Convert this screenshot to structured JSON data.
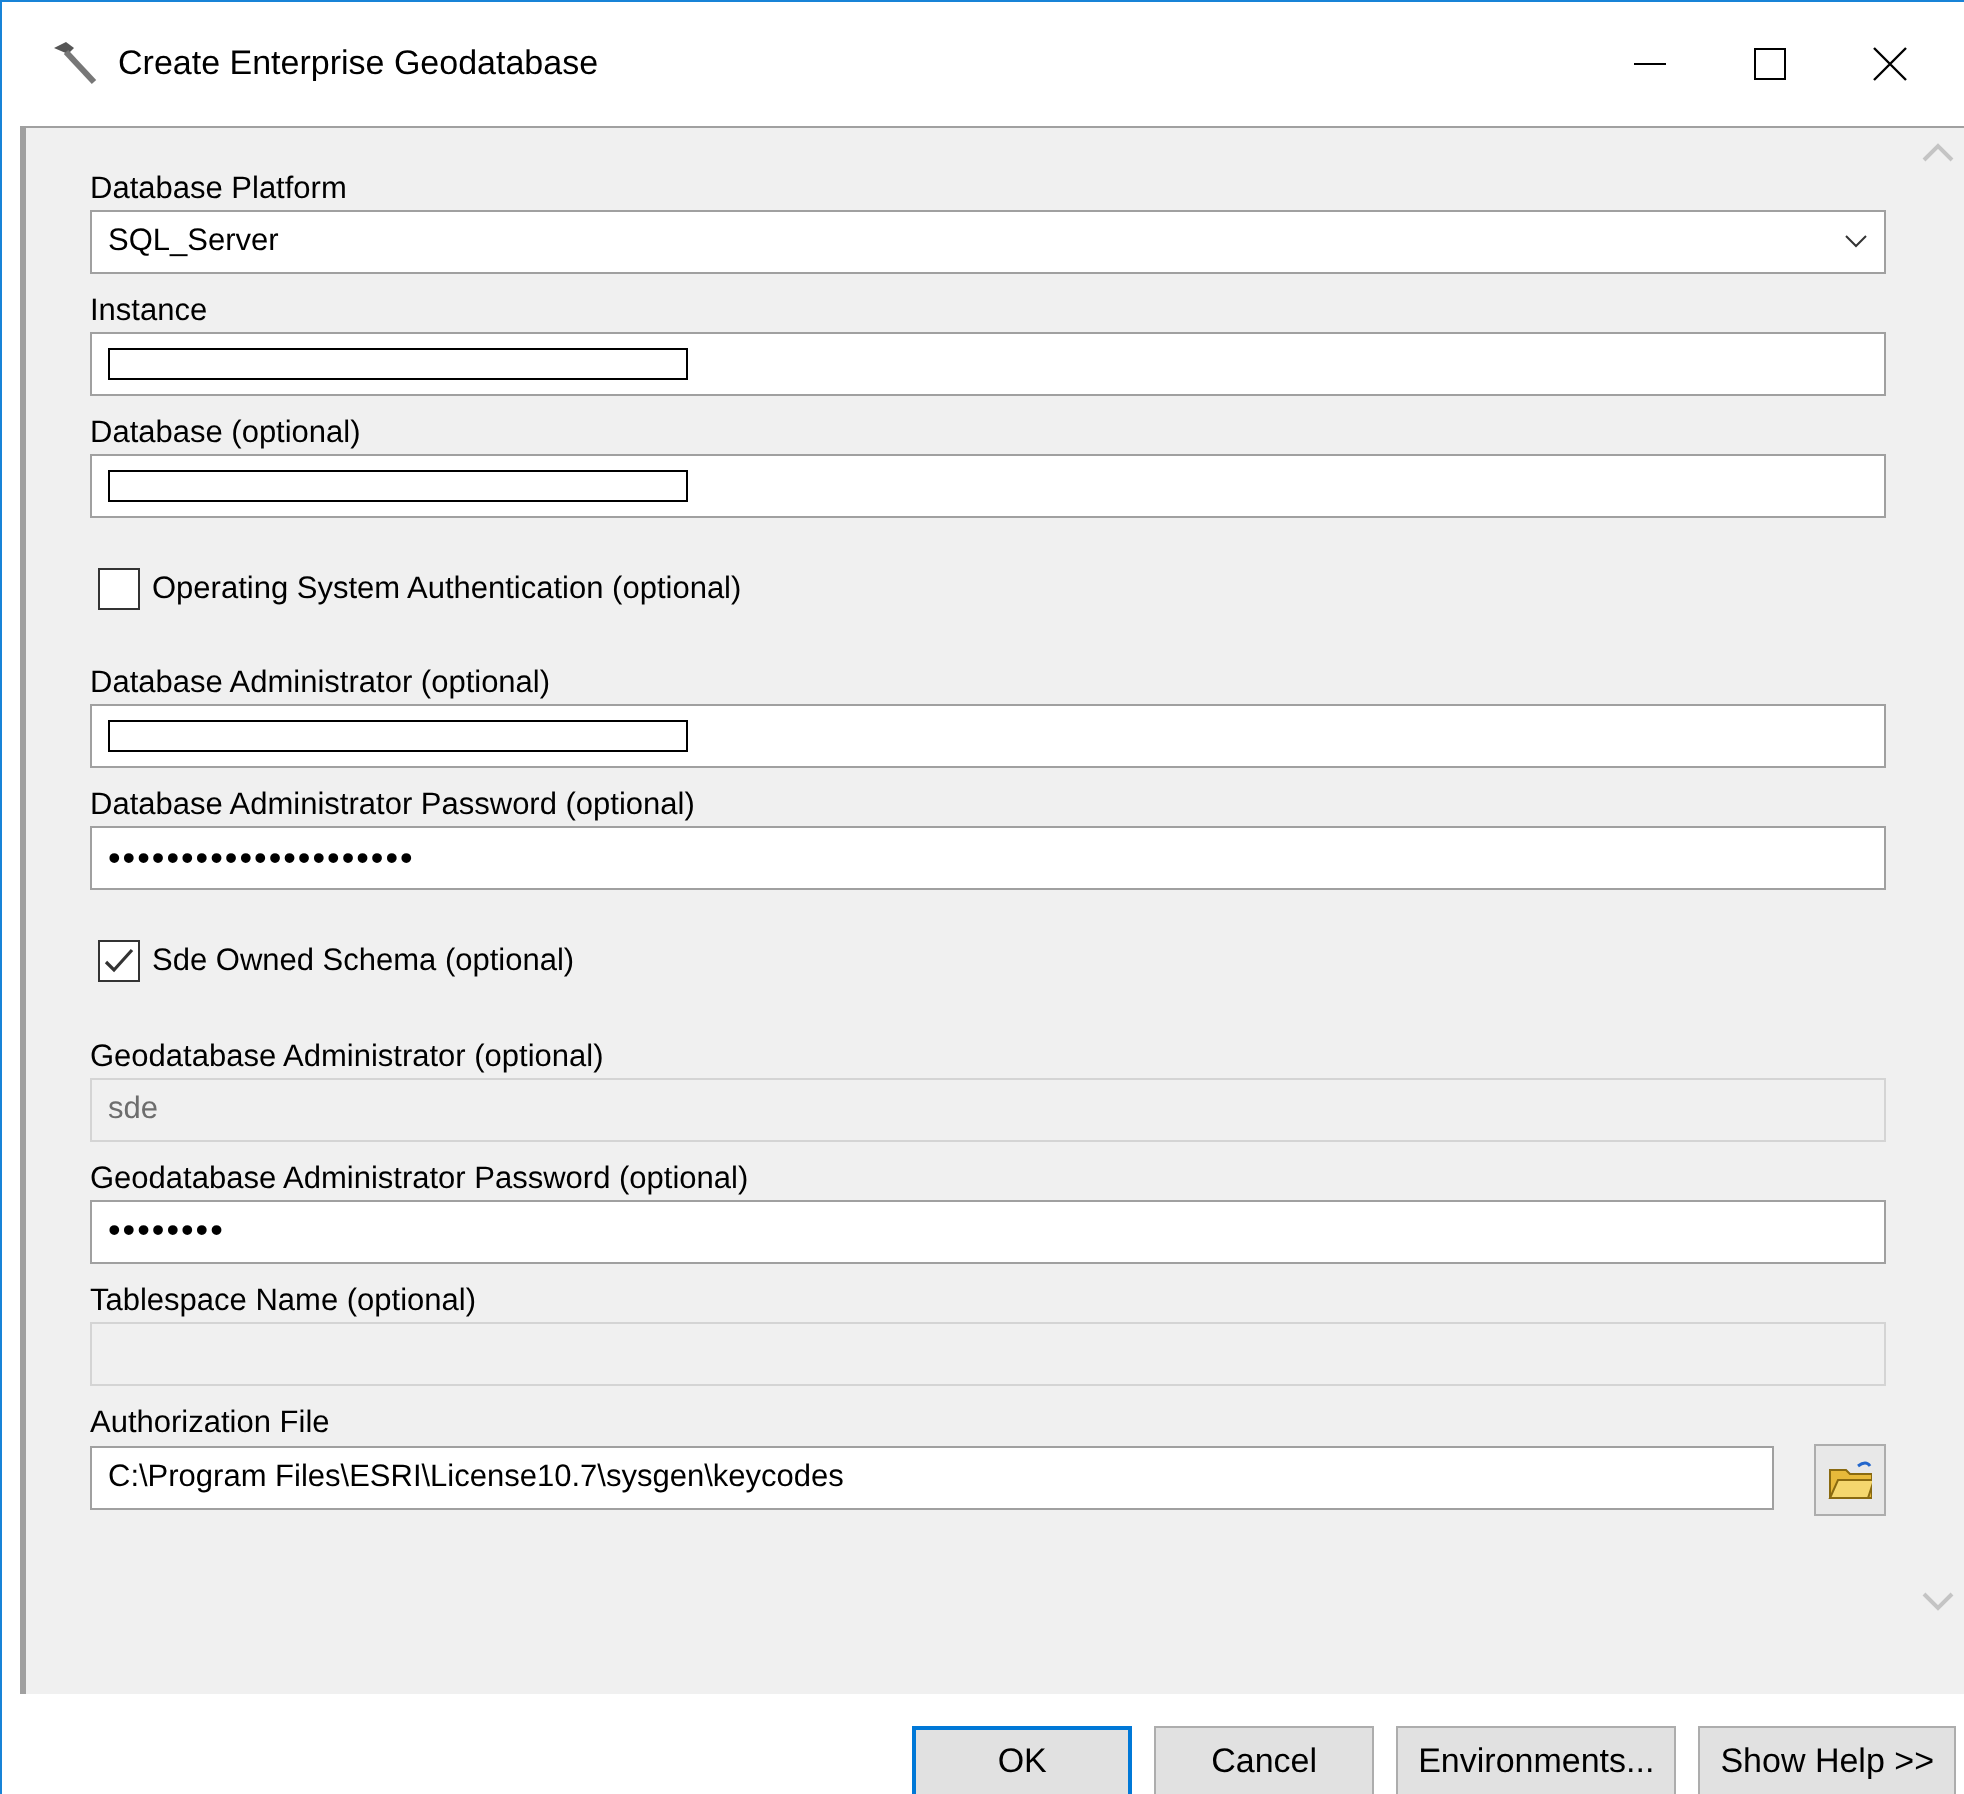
{
  "window": {
    "title": "Create Enterprise Geodatabase"
  },
  "fields": [
    {
      "kind": "dropdown",
      "label": "Database Platform",
      "value": "SQL_Server",
      "disabled": false,
      "redacted": false
    },
    {
      "kind": "text",
      "label": "Instance",
      "disabled": false,
      "redacted": true
    },
    {
      "kind": "text",
      "label": "Database (optional)",
      "disabled": false,
      "redacted": true
    },
    {
      "kind": "checkbox",
      "label": "Operating System Authentication (optional)",
      "checked": false
    },
    {
      "kind": "text",
      "label": "Database Administrator (optional)",
      "disabled": false,
      "redacted": true
    },
    {
      "kind": "text",
      "label": "Database Administrator Password (optional)",
      "value": "•••••••••••••••••••••",
      "disabled": false,
      "redacted": false
    },
    {
      "kind": "checkbox",
      "label": "Sde Owned Schema (optional)",
      "checked": true
    },
    {
      "kind": "text",
      "label": "Geodatabase Administrator (optional)",
      "value": "sde",
      "disabled": true,
      "redacted": false
    },
    {
      "kind": "text",
      "label": "Geodatabase Administrator Password (optional)",
      "value": "••••••••",
      "disabled": false,
      "redacted": false
    },
    {
      "kind": "text",
      "label": "Tablespace Name (optional)",
      "disabled": true,
      "redacted": false
    },
    {
      "kind": "file",
      "label": "Authorization File",
      "value": "C:\\Program Files\\ESRI\\License10.7\\sysgen\\keycodes",
      "disabled": false,
      "redacted": false
    }
  ],
  "buttons": [
    {
      "label": "OK",
      "default": true
    },
    {
      "label": "Cancel",
      "default": false
    },
    {
      "label": "Environments...",
      "default": false
    },
    {
      "label": "Show Help >>",
      "default": false
    }
  ]
}
